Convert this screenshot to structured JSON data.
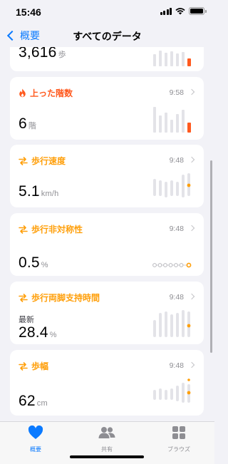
{
  "status": {
    "time": "15:46"
  },
  "nav": {
    "back_label": "概要",
    "title": "すべてのデータ"
  },
  "cards": [
    {
      "title": "",
      "time": "",
      "value": "3,616",
      "unit": "歩",
      "accent": "#ff5a1f"
    },
    {
      "title": "上った階数",
      "time": "9:58",
      "value": "6",
      "unit": "階",
      "accent": "#ff5a1f"
    },
    {
      "title": "歩行速度",
      "time": "9:48",
      "value": "5.1",
      "unit": "km/h",
      "accent": "#ff9f0a"
    },
    {
      "title": "歩行非対称性",
      "time": "9:48",
      "value": "0.5",
      "unit": "%",
      "accent": "#ff9f0a"
    },
    {
      "title": "歩行両脚支持時間",
      "time": "9:48",
      "latest_label": "最新",
      "value": "28.4",
      "unit": "%",
      "accent": "#ff9f0a"
    },
    {
      "title": "歩幅",
      "time": "9:48",
      "value": "62",
      "unit": "cm",
      "accent": "#ff9f0a"
    }
  ],
  "tabs": [
    {
      "label": "概要",
      "icon": "heart-icon",
      "active": true
    },
    {
      "label": "共有",
      "icon": "people-icon",
      "active": false
    },
    {
      "label": "ブラウズ",
      "icon": "grid-icon",
      "active": false
    }
  ],
  "colors": {
    "tint": "#0a7aff",
    "fire": "#ff5a1f",
    "walk": "#ff9f0a",
    "bar": "#e3e3e8"
  }
}
